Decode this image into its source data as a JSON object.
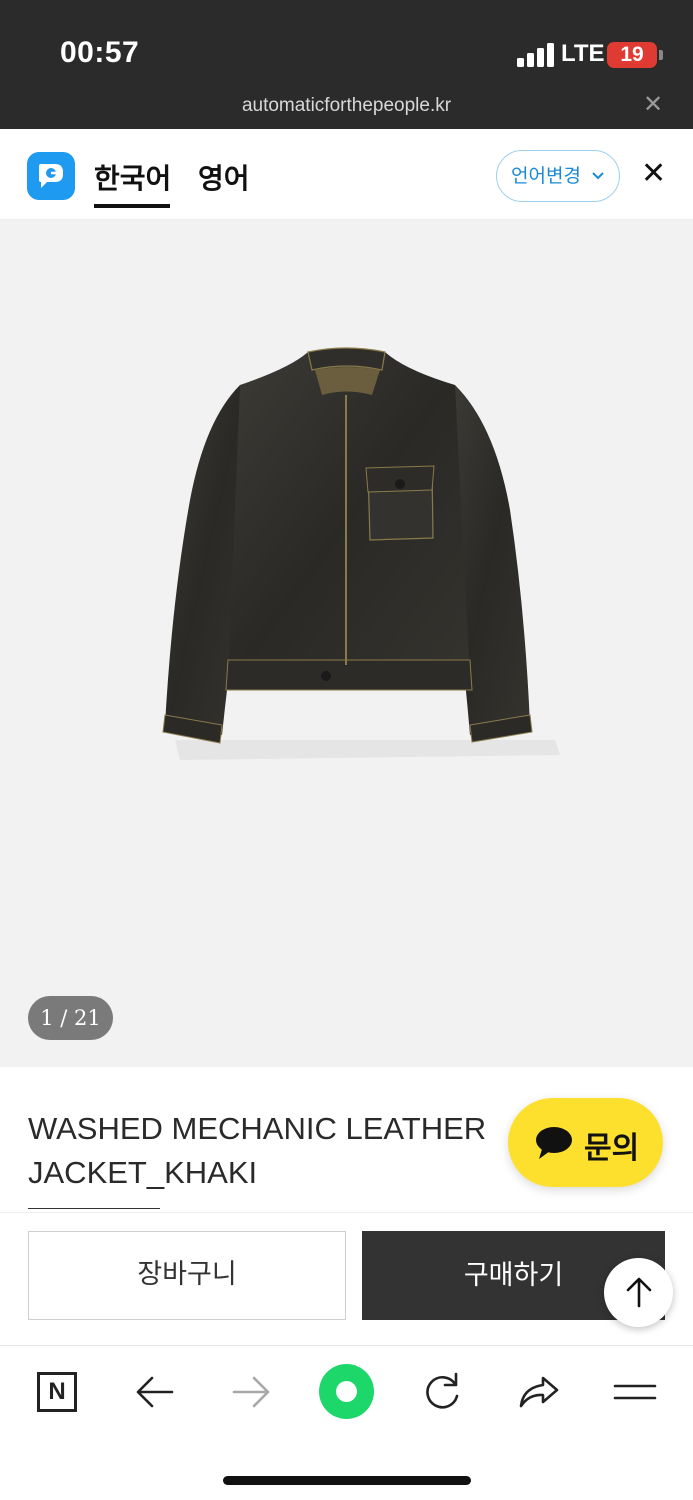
{
  "status_bar": {
    "time": "00:57",
    "network": "LTE",
    "battery": "19",
    "battery_color": "#e03b33"
  },
  "browser": {
    "url": "automaticforthepeople.kr",
    "close_icon": "close-icon"
  },
  "translate_bar": {
    "logo_icon": "papago-logo-icon",
    "tabs": [
      {
        "label": "한국어",
        "active": true
      },
      {
        "label": "영어",
        "active": false
      }
    ],
    "change_language_label": "언어변경",
    "accent_color": "#1a8ad6"
  },
  "product": {
    "image_icon": "leather-jacket-photo",
    "image_counter": "1 / 21",
    "title_line1": "WASHED MECHANIC LEATHER",
    "title_line2": "JACKET_KHAKI"
  },
  "chat": {
    "label": "문의",
    "color": "#fde02d",
    "icon": "speech-bubble-icon"
  },
  "actions": {
    "cart_label": "장바구니",
    "buy_label": "구매하기",
    "scroll_top_icon": "arrow-up-icon"
  },
  "browser_toolbar": {
    "items": [
      "naver-n-icon",
      "back-arrow-icon",
      "forward-arrow-icon",
      "home-dot-icon",
      "refresh-icon",
      "share-icon",
      "menu-icon"
    ],
    "n_label": "N",
    "home_color": "#1ed76a"
  }
}
